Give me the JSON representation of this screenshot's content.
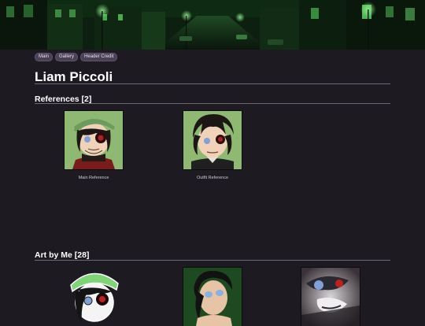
{
  "header": {
    "banner_alt": "night street banner"
  },
  "topnav": {
    "items": [
      {
        "label": "Main"
      },
      {
        "label": "Gallery"
      },
      {
        "label": "Header Credit"
      }
    ]
  },
  "profile": {
    "name": "Liam Piccoli"
  },
  "references": {
    "heading": "References [2]",
    "items": [
      {
        "caption": "Main Reference"
      },
      {
        "caption": "Outfit Reference"
      }
    ]
  },
  "art_by_me": {
    "heading": "Art by Me [28]"
  },
  "colors": {
    "background": "#1e1a22",
    "pill": "#4a4156",
    "rule": "#6e6878",
    "banner_green": "#14361a",
    "thumb_green": "#8fb872"
  }
}
